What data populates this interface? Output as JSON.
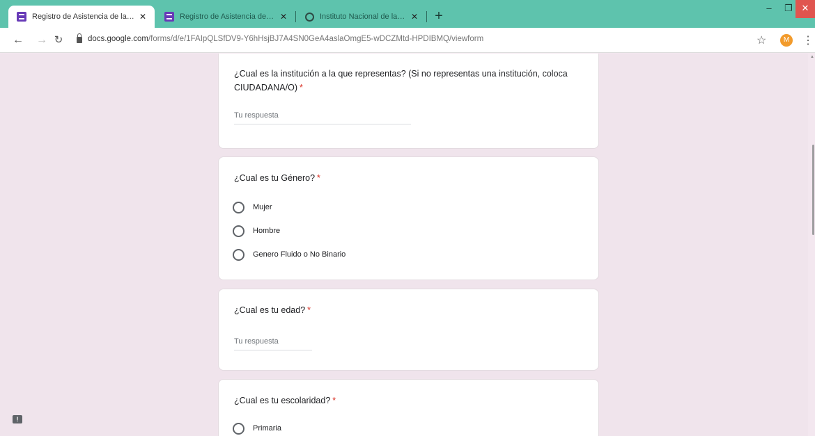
{
  "browser": {
    "tabs": [
      {
        "title": "Registro de Asistencia de la Mes",
        "icon": "google-forms-icon",
        "active": true
      },
      {
        "title": "Registro de Asistencia de la Mes",
        "icon": "google-forms-icon",
        "active": false
      },
      {
        "title": "Instituto Nacional de las Mujeres",
        "icon": "globe-icon",
        "active": false
      }
    ],
    "url_host": "docs.google.com",
    "url_path": "/forms/d/e/1FAIpQLSfDV9-Y6hHsjBJ7A4SN0GeA4aslaOmgE5-wDCZMtd-HPDIBMQ/viewform",
    "avatar_letter": "M"
  },
  "form": {
    "q1": {
      "text": "¿Cual es la institución a la que representas? (Si no representas una institución, coloca CIUDADANA/O)",
      "required": "*",
      "placeholder": "Tu respuesta"
    },
    "q2": {
      "text": "¿Cual es tu Género?",
      "required": "*",
      "options": [
        "Mujer",
        "Hombre",
        "Genero Fluido o No Binario"
      ]
    },
    "q3": {
      "text": "¿Cual es tu edad?",
      "required": "*",
      "placeholder": "Tu respuesta"
    },
    "q4": {
      "text": "¿Cual es tu escolaridad?",
      "required": "*",
      "options": [
        "Primaria"
      ]
    }
  },
  "colors": {
    "tabstrip": "#5ec3ad",
    "page_bg": "#f0e4ec",
    "required": "#d93025",
    "forms_purple": "#673ab7",
    "avatar": "#f29b2c"
  }
}
